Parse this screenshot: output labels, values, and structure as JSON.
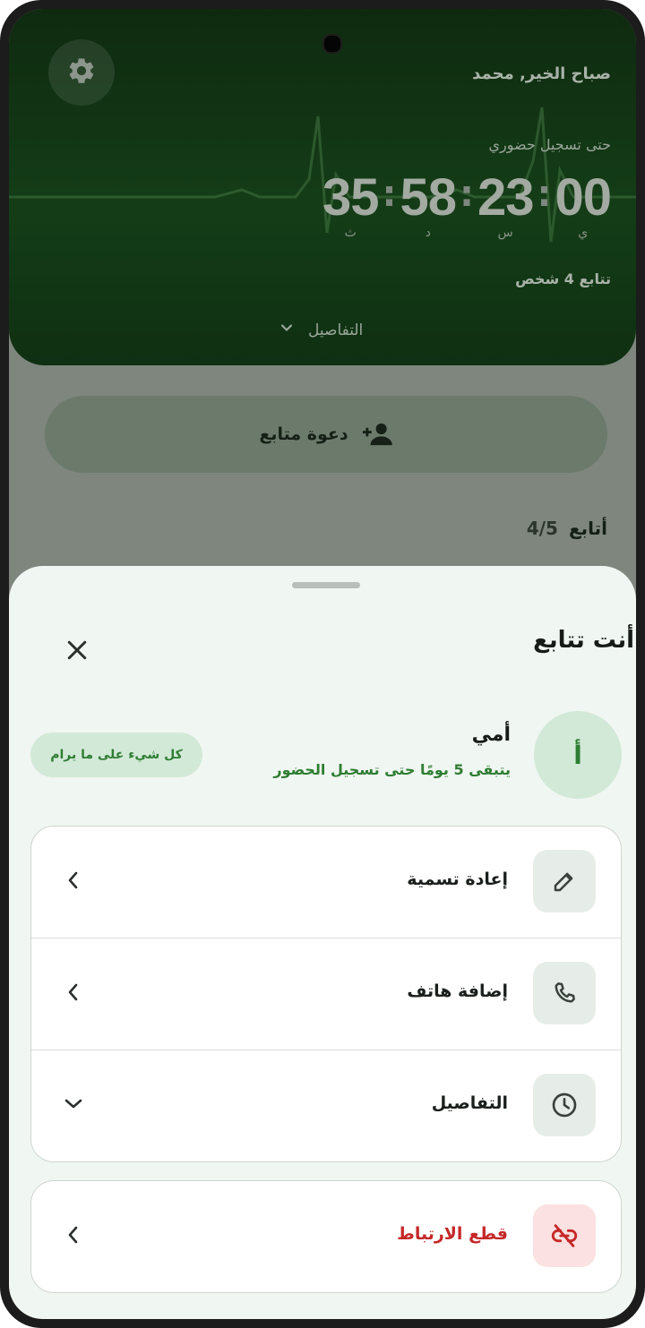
{
  "header": {
    "greeting": "صباح الخير, محمد",
    "countdown_label": "حتى تسجيل حضوري",
    "timer": [
      {
        "value": "00",
        "unit": "ي"
      },
      {
        "value": "23",
        "unit": "س"
      },
      {
        "value": "58",
        "unit": "د"
      },
      {
        "value": "35",
        "unit": "ث"
      }
    ],
    "followers_text": "تتابع 4 شخص",
    "details_label": "التفاصيل",
    "icons": {
      "settings": "gear-icon",
      "details": "chevron-down-icon"
    }
  },
  "invite": {
    "label": "دعوة متابع",
    "icon": "person-add-icon"
  },
  "my_followers": {
    "label": "أتابع",
    "count": "4/5"
  },
  "sheet": {
    "title": "أنت تتابع",
    "close_icon": "close-icon",
    "person": {
      "initial": "أ",
      "name": "أمي",
      "subtitle": "يتبقى 5 يومًا حتى تسجيل الحضور",
      "status": "كل شيء على ما يرام"
    },
    "actions": [
      {
        "label": "إعادة تسمية",
        "icon": "pencil-icon",
        "arrow": "chevron-left-icon"
      },
      {
        "label": "إضافة هاتف",
        "icon": "phone-icon",
        "arrow": "chevron-left-icon"
      },
      {
        "label": "التفاصيل",
        "icon": "clock-icon",
        "arrow": "chevron-down-icon"
      }
    ],
    "danger_action": {
      "label": "قطع الارتباط",
      "icon": "link-off-icon",
      "arrow": "chevron-left-icon"
    }
  },
  "colors": {
    "accent_green": "#2e7d32",
    "danger_red": "#c62828",
    "hero_dark": "#143d17",
    "sheet_bg": "#f0f6f2"
  }
}
